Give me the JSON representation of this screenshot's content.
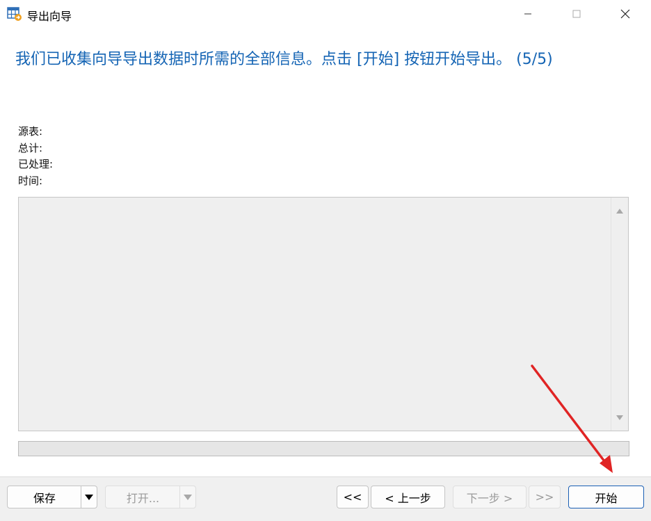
{
  "window": {
    "title": "导出向导"
  },
  "headline": "我们已收集向导导出数据时所需的全部信息。点击 [开始] 按钮开始导出。 (5/5)",
  "info": {
    "source_table_label": "源表:",
    "total_label": "总计:",
    "processed_label": "已处理:",
    "time_label": "时间:"
  },
  "footer": {
    "save_label": "保存",
    "open_label": "打开...",
    "first_label": "<<",
    "prev_label": "< 上一步",
    "next_label": "下一步 >",
    "last_label": ">>",
    "start_label": "开始"
  },
  "colors": {
    "headline": "#1464b4",
    "annotation_arrow": "#e02424",
    "primary_border": "#1a5fb4"
  }
}
